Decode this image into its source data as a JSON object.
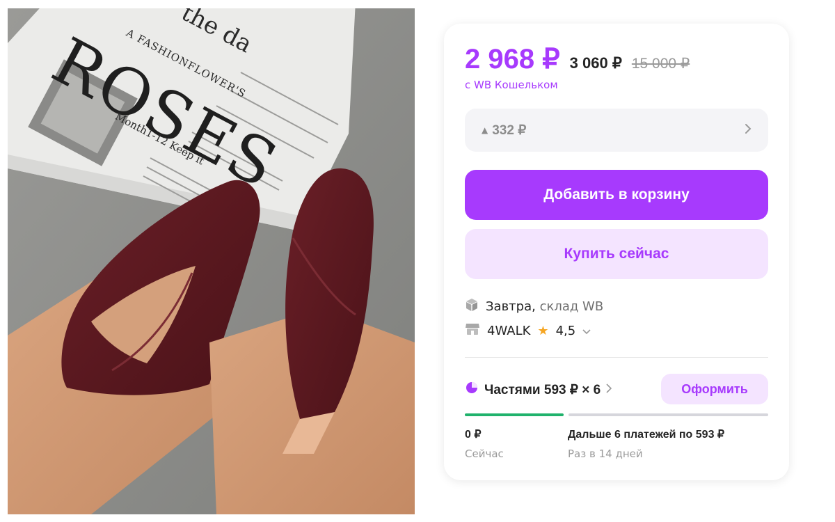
{
  "photo": {
    "magazine": {
      "masthead": "ROSES",
      "top_word": "the da",
      "tagline": "A FASHIONFLOWER'S",
      "subline": "Month1-12 Keep it"
    }
  },
  "buy_box": {
    "price": "2 968 ₽",
    "price_regular": "3 060 ₽",
    "price_old": "15 000 ₽",
    "wallet_note": "с WB Кошельком",
    "discount": {
      "arrow": "▲",
      "value": "332 ₽"
    },
    "add_to_cart": "Добавить в корзину",
    "buy_now": "Купить сейчас",
    "delivery": {
      "icon": "box-icon",
      "day": "Завтра,",
      "source": "склад WB"
    },
    "seller": {
      "icon": "store-icon",
      "name": "4WALK",
      "rating": "4,5"
    },
    "installments": {
      "label": "Частями 593 ₽ × 6",
      "order_button": "Оформить",
      "now_amount": "0 ₽",
      "now_label": "Сейчас",
      "later_amount": "Дальше 6 платежей по 593 ₽",
      "later_label": "Раз в 14 дней"
    }
  },
  "colors": {
    "accent": "#a73afd",
    "accent_soft": "#f4e4ff",
    "progress_now": "#20b26c",
    "star": "#f6a623"
  }
}
